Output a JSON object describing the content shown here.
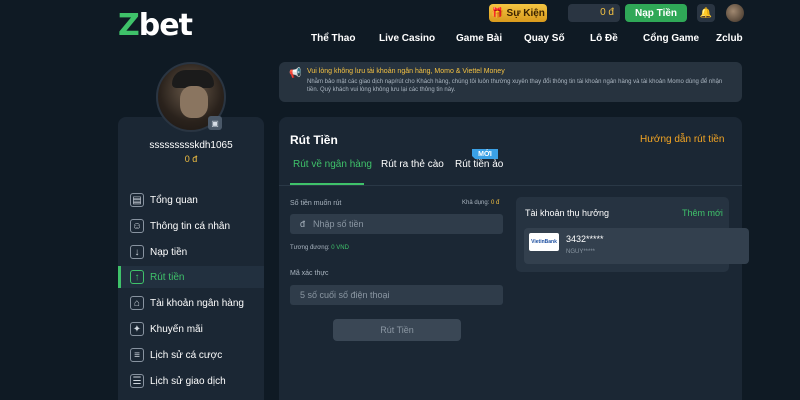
{
  "header": {
    "logo_prefix": "Z",
    "logo_rest": "bet",
    "event_label": "Sự Kiện",
    "balance": "0 đ",
    "deposit_label": "Nạp Tiền"
  },
  "nav": [
    "Thể Thao",
    "Live Casino",
    "Game Bài",
    "Quay Số",
    "Lô Đề",
    "Cổng Game",
    "Zclub"
  ],
  "profile": {
    "username": "ssssssssskdh1065",
    "balance": "0 đ"
  },
  "sidebar": {
    "items": [
      {
        "label": "Tổng quan",
        "icon": "chart-icon"
      },
      {
        "label": "Thông tin cá nhân",
        "icon": "user-icon"
      },
      {
        "label": "Nạp tiền",
        "icon": "deposit-icon"
      },
      {
        "label": "Rút tiền",
        "icon": "withdraw-icon",
        "active": true
      },
      {
        "label": "Tài khoản ngân hàng",
        "icon": "bank-icon"
      },
      {
        "label": "Khuyến mãi",
        "icon": "gift-icon"
      },
      {
        "label": "Lịch sử cá cược",
        "icon": "history-icon"
      },
      {
        "label": "Lịch sử giao dịch",
        "icon": "receipt-icon"
      }
    ]
  },
  "notice": {
    "title": "Vui lòng không lưu tài khoản ngân hàng, Momo & Viettel Money",
    "body": "Nhằm bảo mật các giao dịch nạp/rút cho Khách hàng, chúng tôi luôn thường xuyên thay đổi thông tin tài khoản ngân hàng và tài khoản Momo dùng để nhận tiền. Quý khách vui lòng không lưu lại các thông tin này."
  },
  "main": {
    "title": "Rút Tiền",
    "guide_link": "Hướng dẫn rút tiền",
    "tabs": [
      "Rút về ngân hàng",
      "Rút ra thẻ cào",
      "Rút tiền ảo"
    ],
    "new_badge": "MỚI",
    "amount_label": "Số tiền muốn rút",
    "available_label": "Khả dụng:",
    "available_value": "0 đ",
    "currency_symbol": "đ",
    "amount_placeholder": "Nhập số tiền",
    "equiv_label": "Tương đương:",
    "equiv_value": "0 VND",
    "verify_label": "Mã xác thực",
    "verify_placeholder": "5 số cuối số điện thoại",
    "submit_label": "Rút Tiền"
  },
  "beneficiary": {
    "title": "Tài khoản thụ hưởng",
    "add_new": "Thêm mới",
    "bank_logo": "VietinBank",
    "account_no": "3432*****",
    "account_name": "NGUY*****"
  },
  "colors": {
    "accent_green": "#3fc26a",
    "gold": "#f5c242",
    "orange": "#f5a623",
    "badge_blue": "#3ba1e6"
  }
}
